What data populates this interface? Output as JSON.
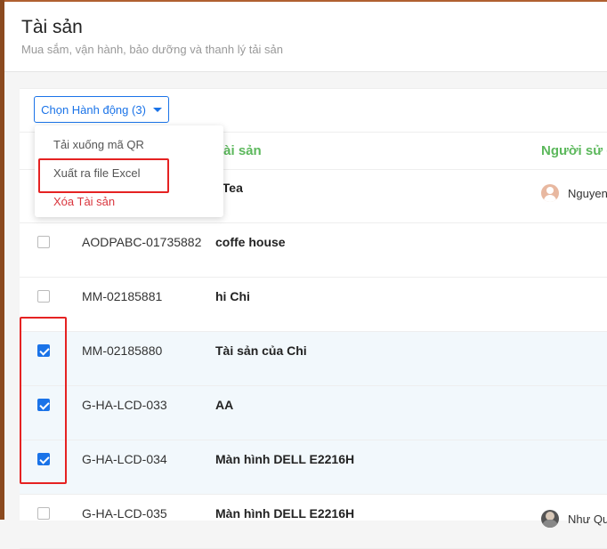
{
  "header": {
    "title": "Tài sản",
    "subtitle": "Mua sắm, vận hành, bảo dưỡng và thanh lý tải sản"
  },
  "toolbar": {
    "action_label": "Chọn Hành động (3)"
  },
  "dropdown": {
    "items": [
      {
        "label": "Tải xuống mã QR",
        "color": "#555555"
      },
      {
        "label": "Xuất ra file Excel",
        "color": "#555555"
      },
      {
        "label": "Xóa Tài sản",
        "color": "#d9363e"
      }
    ]
  },
  "table": {
    "columns": [
      "Tài sản",
      "Người sử d"
    ],
    "rows": [
      {
        "code": "",
        "name": "i Tea",
        "user": "Nguyen",
        "checked": false
      },
      {
        "code": "AODPABC-01735882",
        "name": "coffe house",
        "user": "",
        "checked": false
      },
      {
        "code": "MM-02185881",
        "name": "hi Chi",
        "user": "",
        "checked": false
      },
      {
        "code": "MM-02185880",
        "name": "Tài sản của Chi",
        "user": "",
        "checked": true
      },
      {
        "code": "G-HA-LCD-033",
        "name": "AA",
        "user": "",
        "checked": true
      },
      {
        "code": "G-HA-LCD-034",
        "name": "Màn hình DELL E2216H",
        "user": "",
        "checked": true
      },
      {
        "code": "G-HA-LCD-035",
        "name": "Màn hình DELL E2216H",
        "user": "Như Qu",
        "checked": false
      }
    ]
  },
  "colors": {
    "accent": "#1a73e8",
    "column_header": "#5cb85c",
    "danger": "#d9363e",
    "highlight_box": "#e52222",
    "selected_row": "#f2f8fc"
  }
}
